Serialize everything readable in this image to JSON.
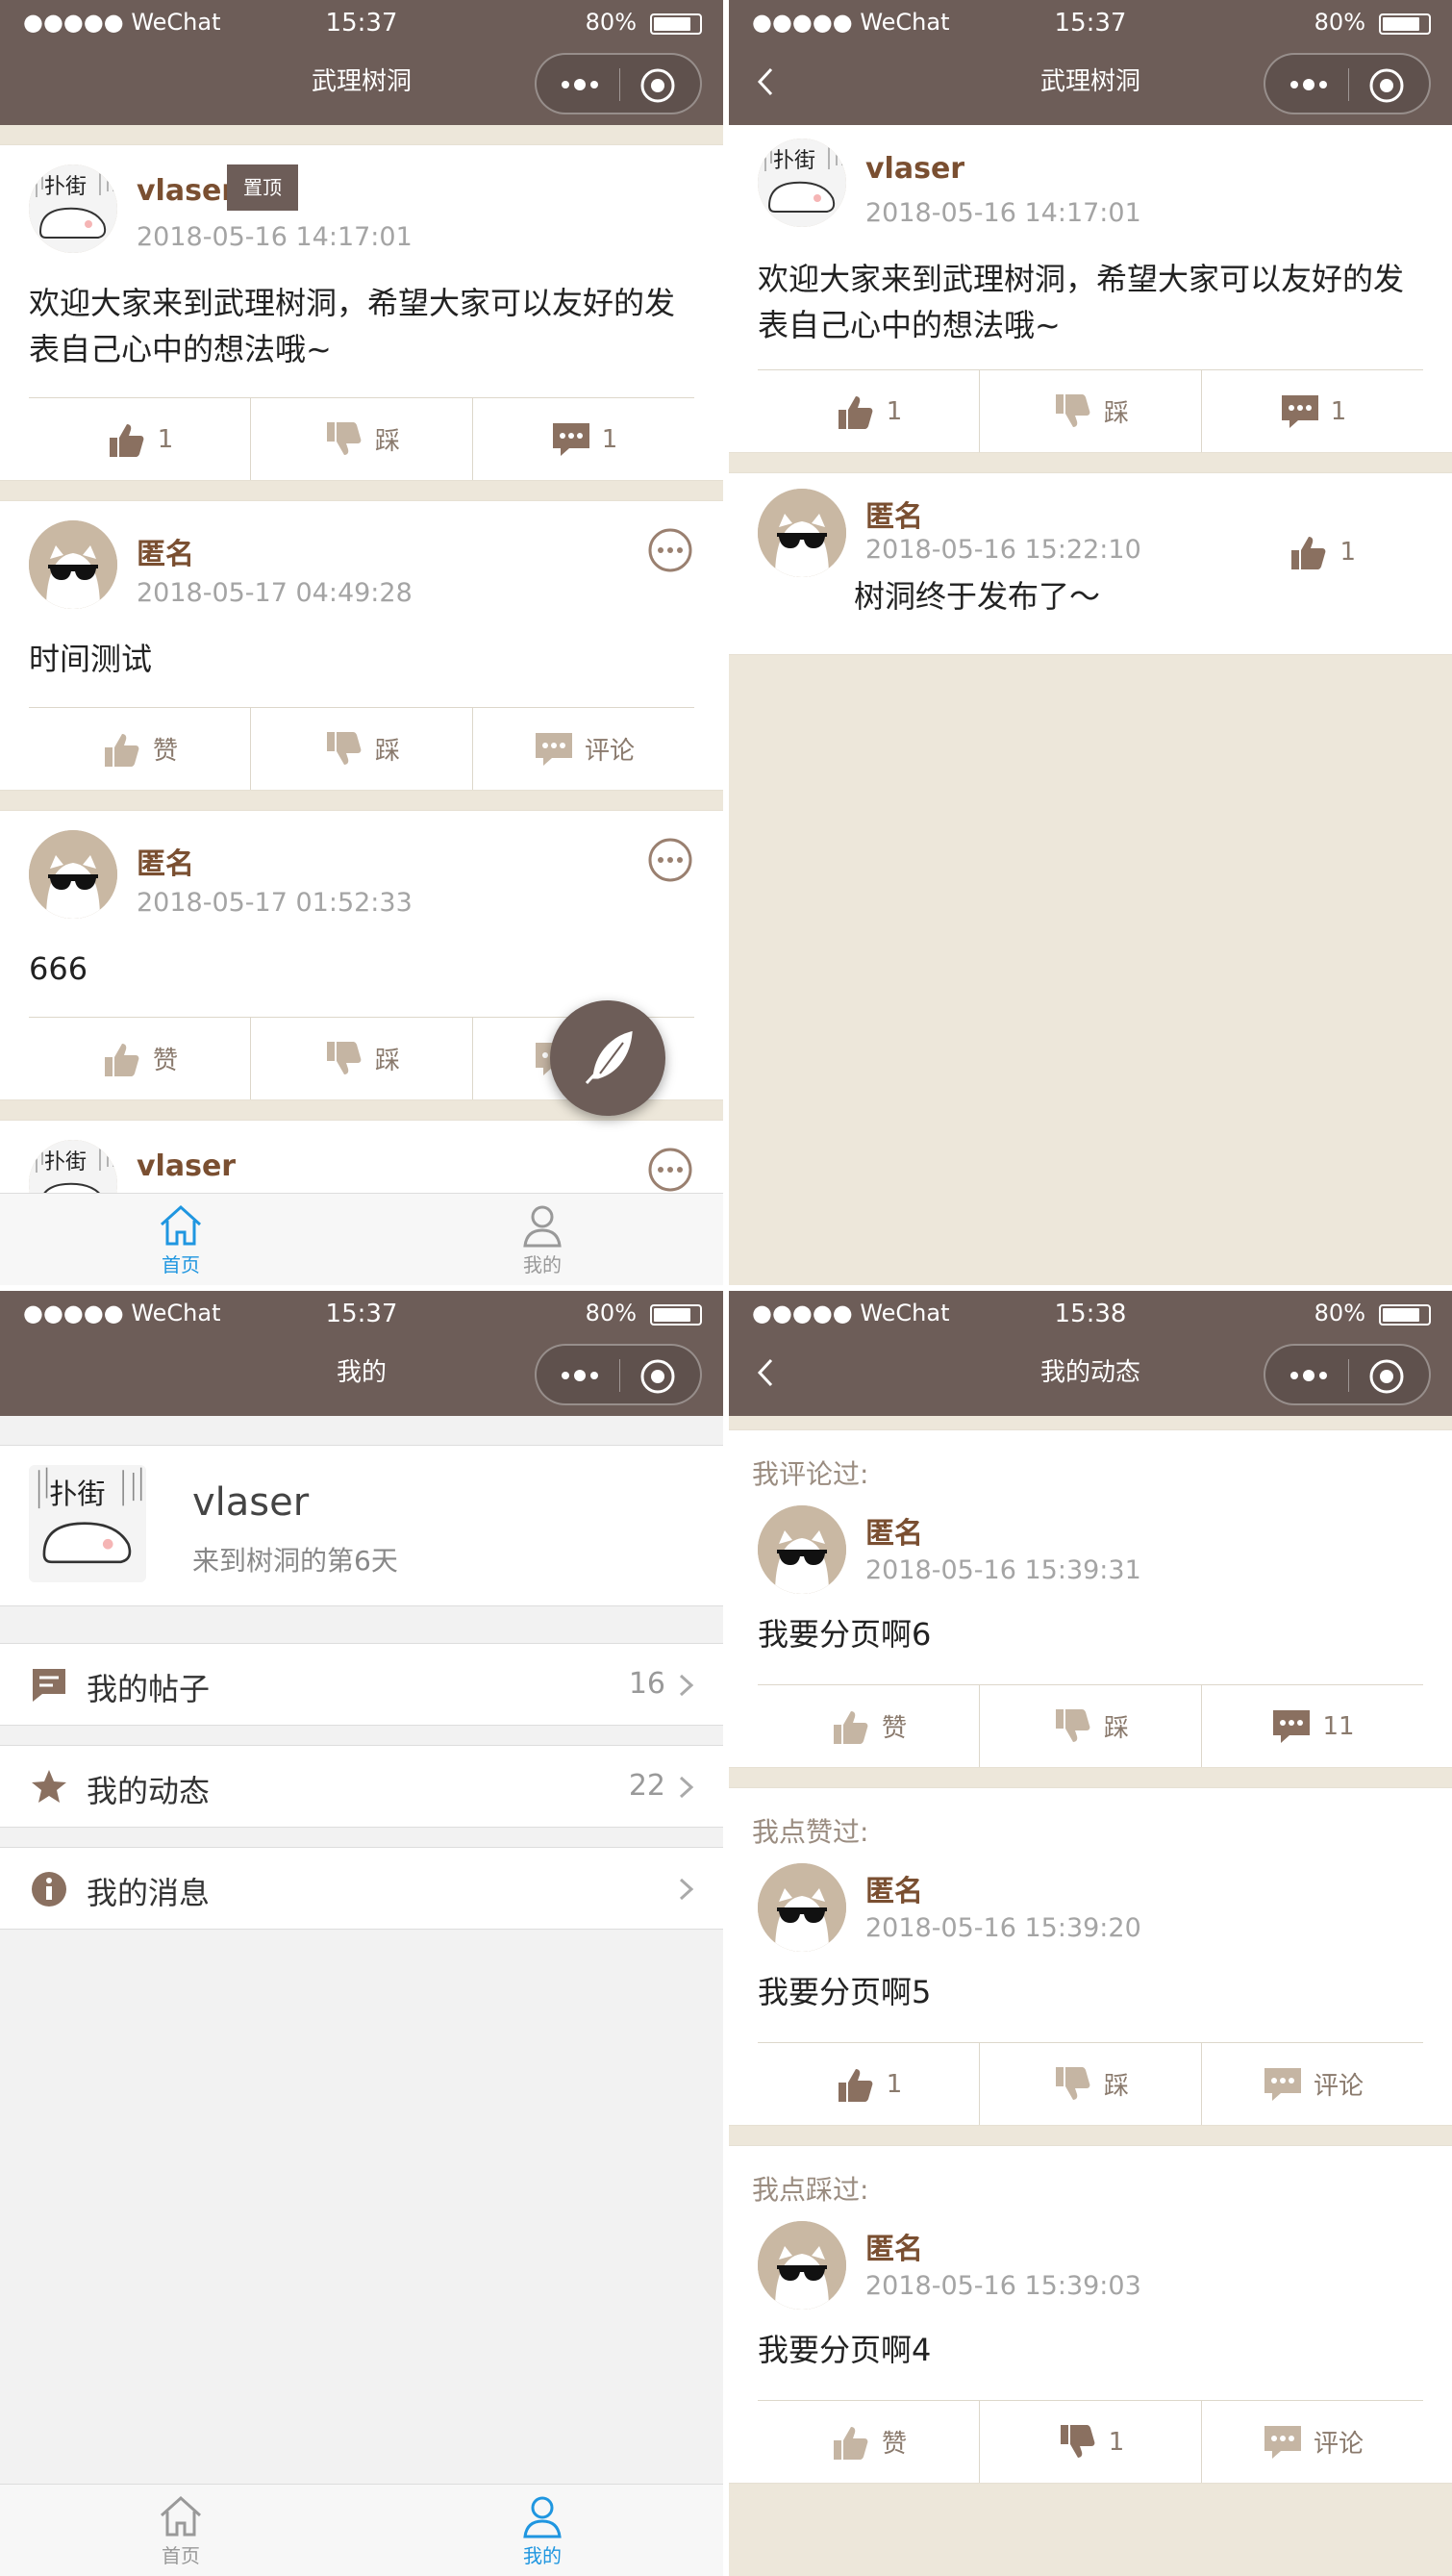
{
  "status": {
    "carrier": "●●●●● WeChat",
    "times": [
      "15:37",
      "15:37",
      "15:37",
      "15:38"
    ],
    "battery": "80%"
  },
  "screen1": {
    "title": "武理树洞",
    "posts": [
      {
        "name": "vlaser",
        "badge": "置顶",
        "time": "2018-05-16 14:17:01",
        "text": "欢迎大家来到武理树洞，希望大家可以友好的发表自己心中的想法哦~",
        "like": "1",
        "dislike": "踩",
        "comment": "1"
      },
      {
        "name": "匿名",
        "time": "2018-05-17 04:49:28",
        "text": "时间测试",
        "like": "赞",
        "dislike": "踩",
        "comment": "评论"
      },
      {
        "name": "匿名",
        "time": "2018-05-17 01:52:33",
        "text": "666",
        "like": "赞",
        "dislike": "踩",
        "comment": "评论"
      },
      {
        "name": "vlaser"
      }
    ],
    "tabs": [
      "首页",
      "我的"
    ]
  },
  "screen2": {
    "title": "武理树洞",
    "post": {
      "name": "vlaser",
      "time": "2018-05-16 14:17:01",
      "text": "欢迎大家来到武理树洞，希望大家可以友好的发表自己心中的想法哦~",
      "like": "1",
      "dislike": "踩",
      "comment": "1"
    },
    "reply": {
      "name": "匿名",
      "time": "2018-05-16 15:22:10",
      "text": "树洞终于发布了～",
      "like": "1"
    }
  },
  "screen3": {
    "title": "我的",
    "username": "vlaser",
    "days": "来到树洞的第6天",
    "menu": [
      {
        "label": "我的帖子",
        "count": "16"
      },
      {
        "label": "我的动态",
        "count": "22"
      },
      {
        "label": "我的消息",
        "count": ""
      }
    ],
    "tabs": [
      "首页",
      "我的"
    ]
  },
  "screen4": {
    "title": "我的动态",
    "sections": [
      {
        "label": "我评论过:",
        "name": "匿名",
        "time": "2018-05-16 15:39:31",
        "text": "我要分页啊6",
        "like": "赞",
        "dislike": "踩",
        "comment": "11"
      },
      {
        "label": "我点赞过:",
        "name": "匿名",
        "time": "2018-05-16 15:39:20",
        "text": "我要分页啊5",
        "like": "1",
        "dislike": "踩",
        "comment": "评论"
      },
      {
        "label": "我点踩过:",
        "name": "匿名",
        "time": "2018-05-16 15:39:03",
        "text": "我要分页啊4",
        "like": "赞",
        "dislike": "1",
        "comment": "评论"
      }
    ]
  },
  "colors": {
    "header": "#6d5d58",
    "accent": "#7a4f31",
    "background": "#ede7da",
    "tabActive": "#1f96e0"
  }
}
